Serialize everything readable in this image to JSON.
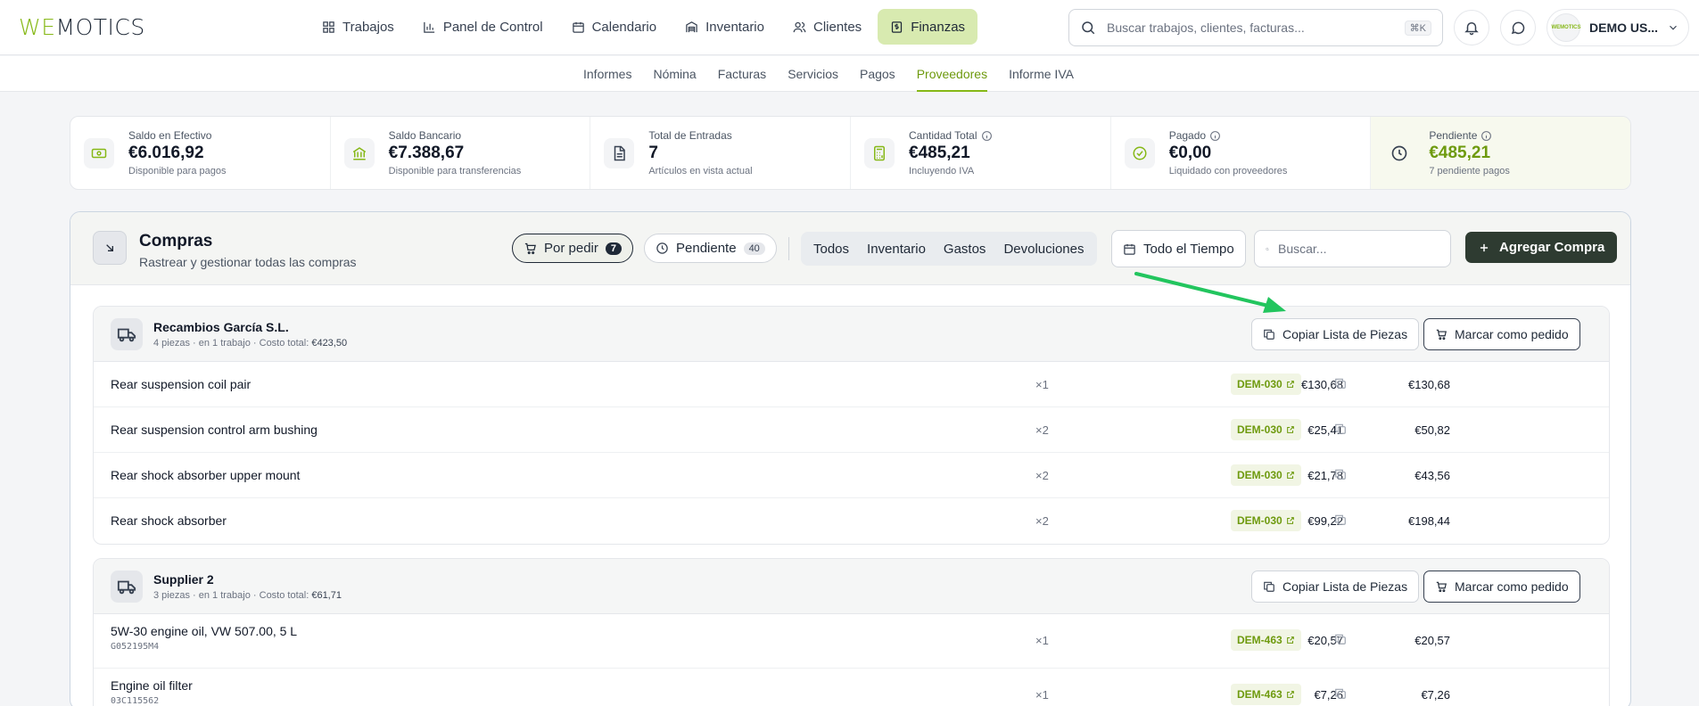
{
  "logo": {
    "part1": "WE",
    "part2": "MOTICS"
  },
  "nav": [
    {
      "label": "Trabajos",
      "icon": "grid-icon"
    },
    {
      "label": "Panel de Control",
      "icon": "bar-chart-icon"
    },
    {
      "label": "Calendario",
      "icon": "calendar-icon"
    },
    {
      "label": "Inventario",
      "icon": "warehouse-icon"
    },
    {
      "label": "Clientes",
      "icon": "users-icon"
    },
    {
      "label": "Finanzas",
      "icon": "dollar-icon",
      "active": true
    }
  ],
  "search": {
    "placeholder": "Buscar trabajos, clientes, facturas...",
    "shortcut": "⌘K"
  },
  "user": {
    "name": "DEMO US...",
    "avatar_text": "WEMOTICS"
  },
  "subnav": [
    "Informes",
    "Nómina",
    "Facturas",
    "Servicios",
    "Pagos",
    "Proveedores",
    "Informe IVA"
  ],
  "subnav_active": "Proveedores",
  "stats": [
    {
      "label": "Saldo en Efectivo",
      "value": "€6.016,92",
      "sub": "Disponible para pagos",
      "icon": "cash-icon",
      "info": false
    },
    {
      "label": "Saldo Bancario",
      "value": "€7.388,67",
      "sub": "Disponible para transferencias",
      "icon": "bank-icon",
      "info": false
    },
    {
      "label": "Total de Entradas",
      "value": "7",
      "sub": "Artículos en vista actual",
      "icon": "document-icon",
      "info": false
    },
    {
      "label": "Cantidad Total",
      "value": "€485,21",
      "sub": "Incluyendo IVA",
      "icon": "calculator-icon",
      "info": true
    },
    {
      "label": "Pagado",
      "value": "€0,00",
      "sub": "Liquidado con proveedores",
      "icon": "check-circle-icon",
      "info": true
    },
    {
      "label": "Pendiente",
      "value": "€485,21",
      "sub": "7 pendiente pagos",
      "icon": "clock-icon",
      "info": true
    }
  ],
  "panel": {
    "title": "Compras",
    "subtitle": "Rastrear y gestionar todas las compras",
    "filter_pills": [
      {
        "label": "Por pedir",
        "count": "7",
        "active": true
      },
      {
        "label": "Pendiente",
        "count": "40",
        "active": false
      }
    ],
    "segments": [
      "Todos",
      "Inventario",
      "Gastos",
      "Devoluciones"
    ],
    "date_filter": "Todo el Tiempo",
    "search_placeholder": "Buscar...",
    "add_button": "Agregar Compra"
  },
  "suppliers": [
    {
      "name": "Recambios García S.L.",
      "meta": "4 piezas · en 1 trabajo · Costo total: ",
      "total": "€423,50",
      "copy_label": "Copiar Lista de Piezas",
      "order_label": "Marcar como pedido",
      "items": [
        {
          "name": "Rear suspension coil pair",
          "code": "",
          "qty": "×1",
          "unit": "€130,68",
          "total": "€130,68",
          "job": "DEM-030"
        },
        {
          "name": "Rear suspension control arm bushing",
          "code": "",
          "qty": "×2",
          "unit": "€25,41",
          "total": "€50,82",
          "job": "DEM-030"
        },
        {
          "name": "Rear shock absorber upper mount",
          "code": "",
          "qty": "×2",
          "unit": "€21,78",
          "total": "€43,56",
          "job": "DEM-030"
        },
        {
          "name": "Rear shock absorber",
          "code": "",
          "qty": "×2",
          "unit": "€99,22",
          "total": "€198,44",
          "job": "DEM-030"
        }
      ]
    },
    {
      "name": "Supplier 2",
      "meta": "3 piezas · en 1 trabajo · Costo total: ",
      "total": "€61,71",
      "copy_label": "Copiar Lista de Piezas",
      "order_label": "Marcar como pedido",
      "items": [
        {
          "name": "5W-30 engine oil, VW 507.00, 5 L",
          "code": "G052195M4",
          "qty": "×1",
          "unit": "€20,57",
          "total": "€20,57",
          "job": "DEM-463"
        },
        {
          "name": "Engine oil filter",
          "code": "03C115562",
          "qty": "×1",
          "unit": "€7,26",
          "total": "€7,26",
          "job": "DEM-463"
        }
      ]
    }
  ],
  "colors": {
    "accent": "#86b817",
    "accent_dark": "#6e9a0e",
    "primary_button": "#2e3b31",
    "annotation_arrow": "#22c55e"
  }
}
